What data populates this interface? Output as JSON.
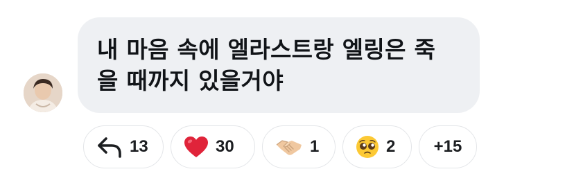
{
  "comment": {
    "text": "내 마음 속에 엘라스트랑 엘링은 죽\n을 때까지 있을거야"
  },
  "reactions": [
    {
      "icon": "reply-arrow-icon",
      "count": "13"
    },
    {
      "icon": "red-heart-icon",
      "count": "30",
      "color": "#e0243a"
    },
    {
      "icon": "handshake-icon",
      "count": "1"
    },
    {
      "icon": "pleading-face-icon",
      "count": "2"
    }
  ],
  "more_reactions": {
    "label": "+15"
  }
}
